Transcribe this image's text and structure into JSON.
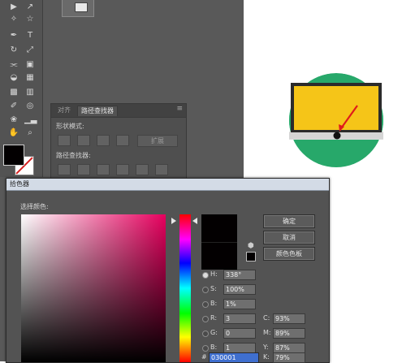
{
  "colors": {
    "workspace": "#595959",
    "current_fill": "#030001",
    "monitor_circle": "#27a86a",
    "monitor_screen": "#f5c518",
    "arrow": "#e01b1b"
  },
  "toolbar": {
    "icons": [
      "selection-tool-icon",
      "direct-selection-tool-icon",
      "magic-wand-icon",
      "pen-tool-icon",
      "lasso-icon",
      "type-tool-icon",
      "rotate-icon",
      "scale-icon",
      "width-tool-icon",
      "free-transform-icon",
      "shape-builder-icon",
      "perspective-grid-icon",
      "mesh-icon",
      "gradient-icon",
      "eyedropper-icon",
      "blend-icon",
      "symbol-sprayer-icon",
      "column-graph-icon",
      "artboard-icon",
      "slice-icon",
      "hand-icon",
      "zoom-icon"
    ]
  },
  "pathfinder_panel": {
    "tabs": [
      "对齐",
      "路径查找器"
    ],
    "shape_modes_label": "形状模式:",
    "expand_label": "扩展",
    "pathfinders_label": "路径查找器:",
    "menu_icon": "panel-menu-icon"
  },
  "color_picker": {
    "title": "拾色器",
    "select_color_label": "选择颜色:",
    "buttons": {
      "ok": "确定",
      "cancel": "取消",
      "swatches": "颜色色板"
    },
    "hsb": [
      {
        "label": "H:",
        "value": "338°",
        "unit": "",
        "selected": true
      },
      {
        "label": "S:",
        "value": "100%",
        "unit": "",
        "selected": false
      },
      {
        "label": "B:",
        "value": "1%",
        "unit": "",
        "selected": false
      }
    ],
    "rgb": [
      {
        "label": "R:",
        "value": "3",
        "selected": false
      },
      {
        "label": "G:",
        "value": "0",
        "selected": false
      },
      {
        "label": "B:",
        "value": "1",
        "selected": false
      }
    ],
    "cmyk": [
      {
        "label": "C:",
        "value": "93%"
      },
      {
        "label": "M:",
        "value": "89%"
      },
      {
        "label": "Y:",
        "value": "87%"
      },
      {
        "label": "K:",
        "value": "79%"
      }
    ],
    "hex_label": "#",
    "hex_value": "030001"
  }
}
